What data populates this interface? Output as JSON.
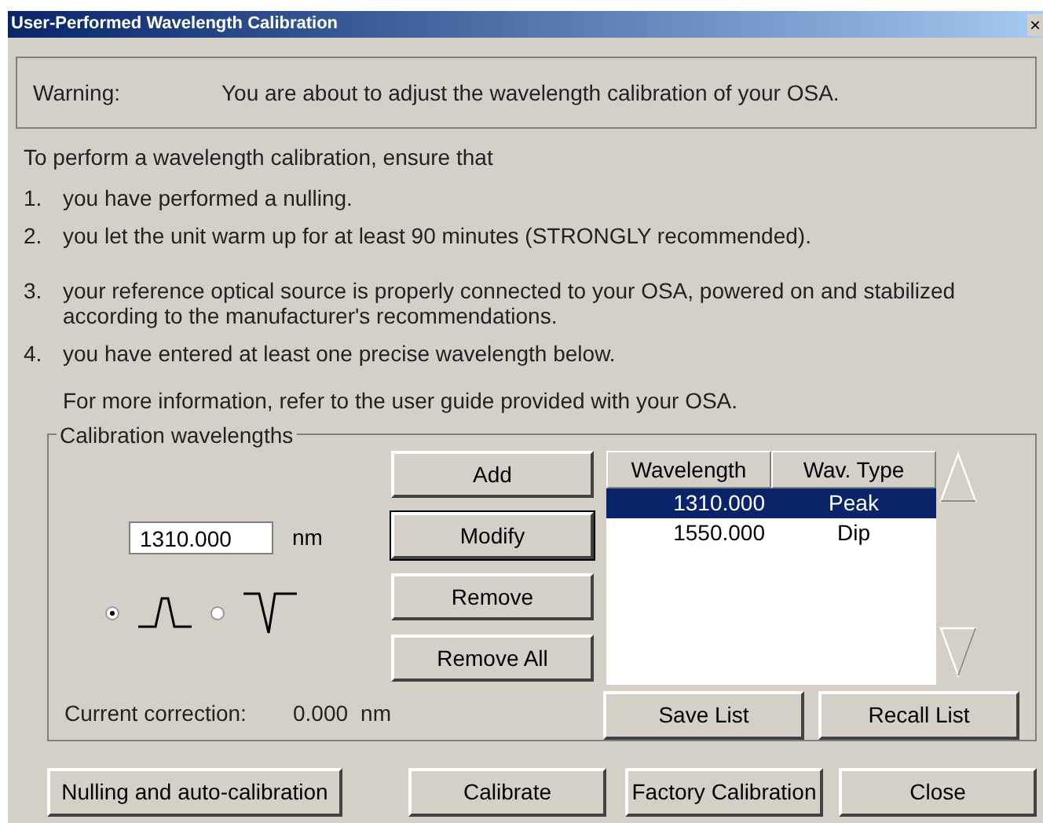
{
  "window": {
    "title": "User-Performed Wavelength Calibration",
    "close": "×"
  },
  "warning": {
    "label": "Warning:",
    "text": "You are about to adjust the wavelength calibration of your OSA."
  },
  "intro": "To perform a wavelength calibration, ensure that",
  "steps": [
    {
      "number": "1.",
      "text": "you have performed a nulling."
    },
    {
      "number": "2.",
      "text": "you let the unit warm up for at least 90 minutes (STRONGLY recommended)."
    },
    {
      "number": "3.",
      "text": "your reference optical source is properly connected to your OSA, powered on and stabilized according to the manufacturer's recommendations."
    },
    {
      "number": "4.",
      "text": "you have entered at least one precise wavelength below."
    }
  ],
  "more_info": "For more information, refer to the user guide provided with your OSA.",
  "group": {
    "title": "Calibration wavelengths",
    "wavelength_field": {
      "value": "1310.000",
      "unit": "nm"
    },
    "types": [
      {
        "kind": "peak",
        "selected": true
      },
      {
        "kind": "dip",
        "selected": false
      }
    ],
    "buttons": [
      {
        "label": "Add",
        "focused": false
      },
      {
        "label": "Modify",
        "focused": true
      },
      {
        "label": "Remove",
        "focused": false
      },
      {
        "label": "Remove All",
        "focused": false
      }
    ],
    "table": {
      "columns": [
        "Wavelength",
        "Wav. Type"
      ],
      "rows": [
        {
          "wavelength": "1310.000",
          "type": "Peak",
          "selected": true
        },
        {
          "wavelength": "1550.000",
          "type": "Dip",
          "selected": false
        }
      ]
    },
    "list_buttons": [
      "Save List",
      "Recall List"
    ],
    "correction": {
      "label": "Current correction:",
      "value": "0.000",
      "unit": "nm"
    }
  },
  "footer_buttons": [
    "Nulling and auto-calibration",
    "Calibrate",
    "Factory Calibration",
    "Close"
  ]
}
